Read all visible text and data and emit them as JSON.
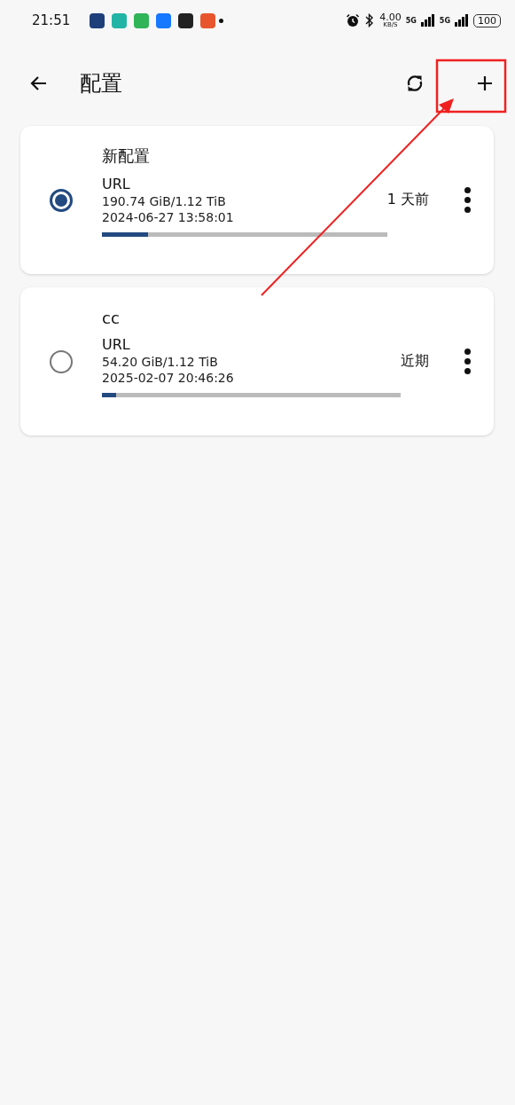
{
  "status_bar": {
    "time": "21:51",
    "app_icons": [
      {
        "color": "#1f3f7a"
      },
      {
        "color": "#22b5a5"
      },
      {
        "color": "#2fb457"
      },
      {
        "color": "#1677ff"
      },
      {
        "color": "#222222"
      },
      {
        "color": "#e8552c"
      }
    ],
    "speed": "4.00",
    "speed_unit": "KB/S",
    "network_1": "5G",
    "network_2": "5G",
    "battery": "100"
  },
  "app_bar": {
    "title": "配置"
  },
  "profiles": [
    {
      "name": "新配置",
      "type": "URL",
      "usage": "190.74 GiB/1.12 TiB",
      "date": "2024-06-27 13:58:01",
      "updated": "1 天前",
      "level": 0.163,
      "selected": true
    },
    {
      "name": "cc",
      "type": "URL",
      "usage": "54.20 GiB/1.12 TiB",
      "date": "2025-02-07 20:46:26",
      "updated": "近期",
      "level": 0.047,
      "selected": false
    }
  ],
  "annotation": {
    "shown": true
  }
}
